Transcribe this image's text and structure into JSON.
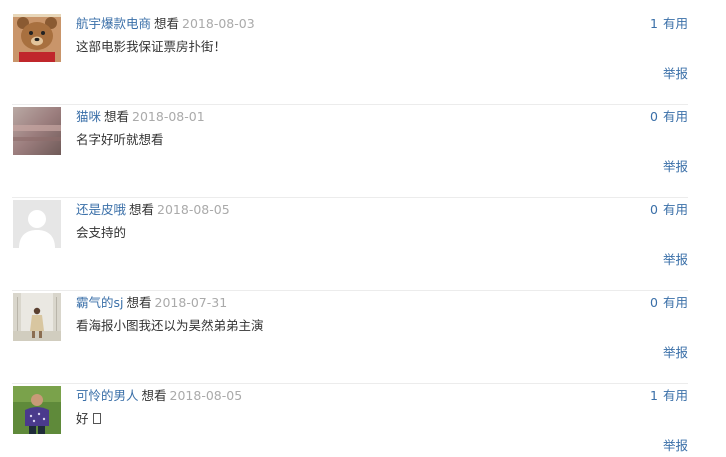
{
  "comments": [
    {
      "username": "航宇爆款电商",
      "status": "想看",
      "date": "2018-08-03",
      "useful_count": "1",
      "useful_label": "有用",
      "content": "这部电影我保证票房扑街！",
      "report_label": "举报",
      "avatar_icon": "teddy-bear-avatar"
    },
    {
      "username": "猫咪",
      "status": "想看",
      "date": "2018-08-01",
      "useful_count": "0",
      "useful_label": "有用",
      "content": "名字好听就想看",
      "report_label": "举报",
      "avatar_icon": "blurry-photo-avatar"
    },
    {
      "username": "还是皮哦",
      "status": "想看",
      "date": "2018-08-05",
      "useful_count": "0",
      "useful_label": "有用",
      "content": "会支持的",
      "report_label": "举报",
      "avatar_icon": "default-user-avatar"
    },
    {
      "username": "霸气的sj",
      "status": "想看",
      "date": "2018-07-31",
      "useful_count": "0",
      "useful_label": "有用",
      "content": "看海报小图我还以为昊然弟弟主演",
      "report_label": "举报",
      "avatar_icon": "person-photo-avatar"
    },
    {
      "username": "可怜的男人",
      "status": "想看",
      "date": "2018-08-05",
      "useful_count": "1",
      "useful_label": "有用",
      "content": "好",
      "report_label": "举报",
      "avatar_icon": "man-photo-avatar"
    }
  ],
  "colors": {
    "link": "#3a6fa8",
    "date": "#aaaaaa",
    "text": "#333333",
    "divider": "#ececec"
  }
}
